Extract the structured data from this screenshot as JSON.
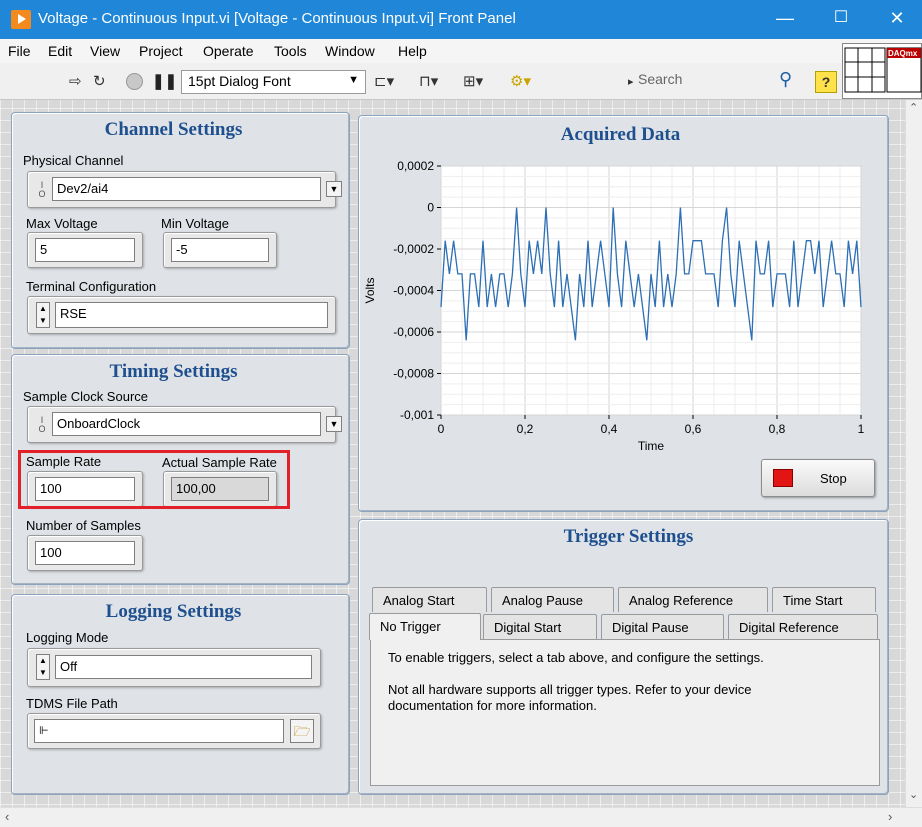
{
  "window": {
    "title": "Voltage - Continuous Input.vi [Voltage - Continuous Input.vi] Front Panel",
    "minimize": "—",
    "maximize": "☐",
    "close": "✕"
  },
  "menu": [
    "File",
    "Edit",
    "View",
    "Project",
    "Operate",
    "Tools",
    "Window",
    "Help"
  ],
  "toolbar": {
    "font": "15pt Dialog Font",
    "search_placeholder": "Search",
    "help": "?",
    "context_icon_text": "DAQmx"
  },
  "channel": {
    "title": "Channel Settings",
    "physical_channel_label": "Physical Channel",
    "physical_channel": "Dev2/ai4",
    "max_voltage_label": "Max Voltage",
    "max_voltage": "5",
    "min_voltage_label": "Min Voltage",
    "min_voltage": "-5",
    "terminal_label": "Terminal Configuration",
    "terminal": "RSE"
  },
  "timing": {
    "title": "Timing Settings",
    "clock_label": "Sample Clock Source",
    "clock": "OnboardClock",
    "rate_label": "Sample Rate",
    "rate": "100",
    "actual_rate_label": "Actual Sample Rate",
    "actual_rate": "100,00",
    "samples_label": "Number of Samples",
    "samples": "100"
  },
  "logging": {
    "title": "Logging Settings",
    "mode_label": "Logging Mode",
    "mode": "Off",
    "path_label": "TDMS File Path",
    "path": ""
  },
  "graph": {
    "title": "Acquired Data",
    "stop": "Stop"
  },
  "chart_data": {
    "type": "line",
    "title": "Acquired Data",
    "xlabel": "Time",
    "ylabel": "Volts",
    "xlim": [
      0,
      1
    ],
    "ylim": [
      -0.001,
      0.0002
    ],
    "xticks": [
      "0",
      "0,2",
      "0,4",
      "0,6",
      "0,8",
      "1"
    ],
    "yticks": [
      "0,0002",
      "0",
      "-0,0002",
      "-0,0004",
      "-0,0006",
      "-0,0008",
      "-0,001"
    ],
    "grid": true,
    "series": [
      {
        "color": "#2c6fb5",
        "x": [
          0,
          0.01,
          0.02,
          0.03,
          0.04,
          0.05,
          0.06,
          0.07,
          0.08,
          0.09,
          0.1,
          0.11,
          0.12,
          0.13,
          0.14,
          0.15,
          0.16,
          0.17,
          0.18,
          0.19,
          0.2,
          0.21,
          0.22,
          0.23,
          0.24,
          0.25,
          0.26,
          0.27,
          0.28,
          0.29,
          0.3,
          0.31,
          0.32,
          0.33,
          0.34,
          0.35,
          0.36,
          0.37,
          0.38,
          0.39,
          0.4,
          0.41,
          0.42,
          0.43,
          0.44,
          0.45,
          0.46,
          0.47,
          0.48,
          0.49,
          0.5,
          0.51,
          0.52,
          0.53,
          0.54,
          0.55,
          0.56,
          0.57,
          0.58,
          0.59,
          0.6,
          0.61,
          0.62,
          0.63,
          0.64,
          0.65,
          0.66,
          0.67,
          0.68,
          0.69,
          0.7,
          0.71,
          0.72,
          0.73,
          0.74,
          0.75,
          0.76,
          0.77,
          0.78,
          0.79,
          0.8,
          0.81,
          0.82,
          0.83,
          0.84,
          0.85,
          0.86,
          0.87,
          0.88,
          0.89,
          0.9,
          0.91,
          0.92,
          0.93,
          0.94,
          0.95,
          0.96,
          0.97,
          0.98,
          0.99,
          1
        ],
        "y": [
          -0.00048,
          -0.00016,
          -0.00032,
          -0.00016,
          -0.00032,
          -0.00032,
          -0.00064,
          -0.00032,
          -0.00032,
          -0.00048,
          -0.00016,
          -0.00048,
          -0.00032,
          -0.00048,
          -0.00032,
          -0.00032,
          -0.00048,
          -0.00032,
          0,
          -0.00032,
          -0.00048,
          -0.00016,
          -0.00032,
          -0.00016,
          -0.00032,
          0,
          -0.00032,
          -0.00048,
          -0.00016,
          -0.00048,
          -0.00032,
          -0.00048,
          -0.00064,
          -0.00032,
          -0.00048,
          -0.00016,
          -0.00048,
          -0.00032,
          -0.00016,
          -0.00032,
          -0.00048,
          0,
          -0.00032,
          -0.00048,
          -0.00016,
          -0.00032,
          -0.00048,
          -0.00032,
          -0.00048,
          -0.00064,
          -0.00032,
          -0.00048,
          -0.00016,
          -0.00048,
          -0.00032,
          -0.00048,
          -0.00032,
          0,
          -0.00032,
          -0.00032,
          -0.00016,
          -0.00016,
          -0.00016,
          -0.00032,
          -0.00032,
          -0.00032,
          -0.00048,
          -0.00016,
          0,
          -0.00032,
          -0.00048,
          -0.00016,
          -0.00032,
          -0.00048,
          -0.00064,
          -0.00016,
          -0.00032,
          -0.00032,
          -0.00016,
          -0.00048,
          -0.00032,
          -0.00032,
          -0.00032,
          -0.00048,
          -0.00016,
          -0.00048,
          -0.00032,
          -0.00016,
          -0.00016,
          -0.00032,
          -0.00016,
          -0.00048,
          -0.00032,
          -0.00016,
          -0.00032,
          -0.00032,
          -0.00048,
          -0.00016,
          -0.00032,
          -0.00016,
          -0.00048
        ]
      }
    ]
  },
  "trigger": {
    "title": "Trigger Settings",
    "tabs_back": [
      "Analog Start",
      "Analog Pause",
      "Analog Reference",
      "Time Start"
    ],
    "tabs_front": [
      "No Trigger",
      "Digital Start",
      "Digital Pause",
      "Digital Reference"
    ],
    "text1": "To enable triggers, select a tab above, and configure the settings.",
    "text2": "Not all hardware supports all trigger types. Refer to your device documentation for more information."
  }
}
